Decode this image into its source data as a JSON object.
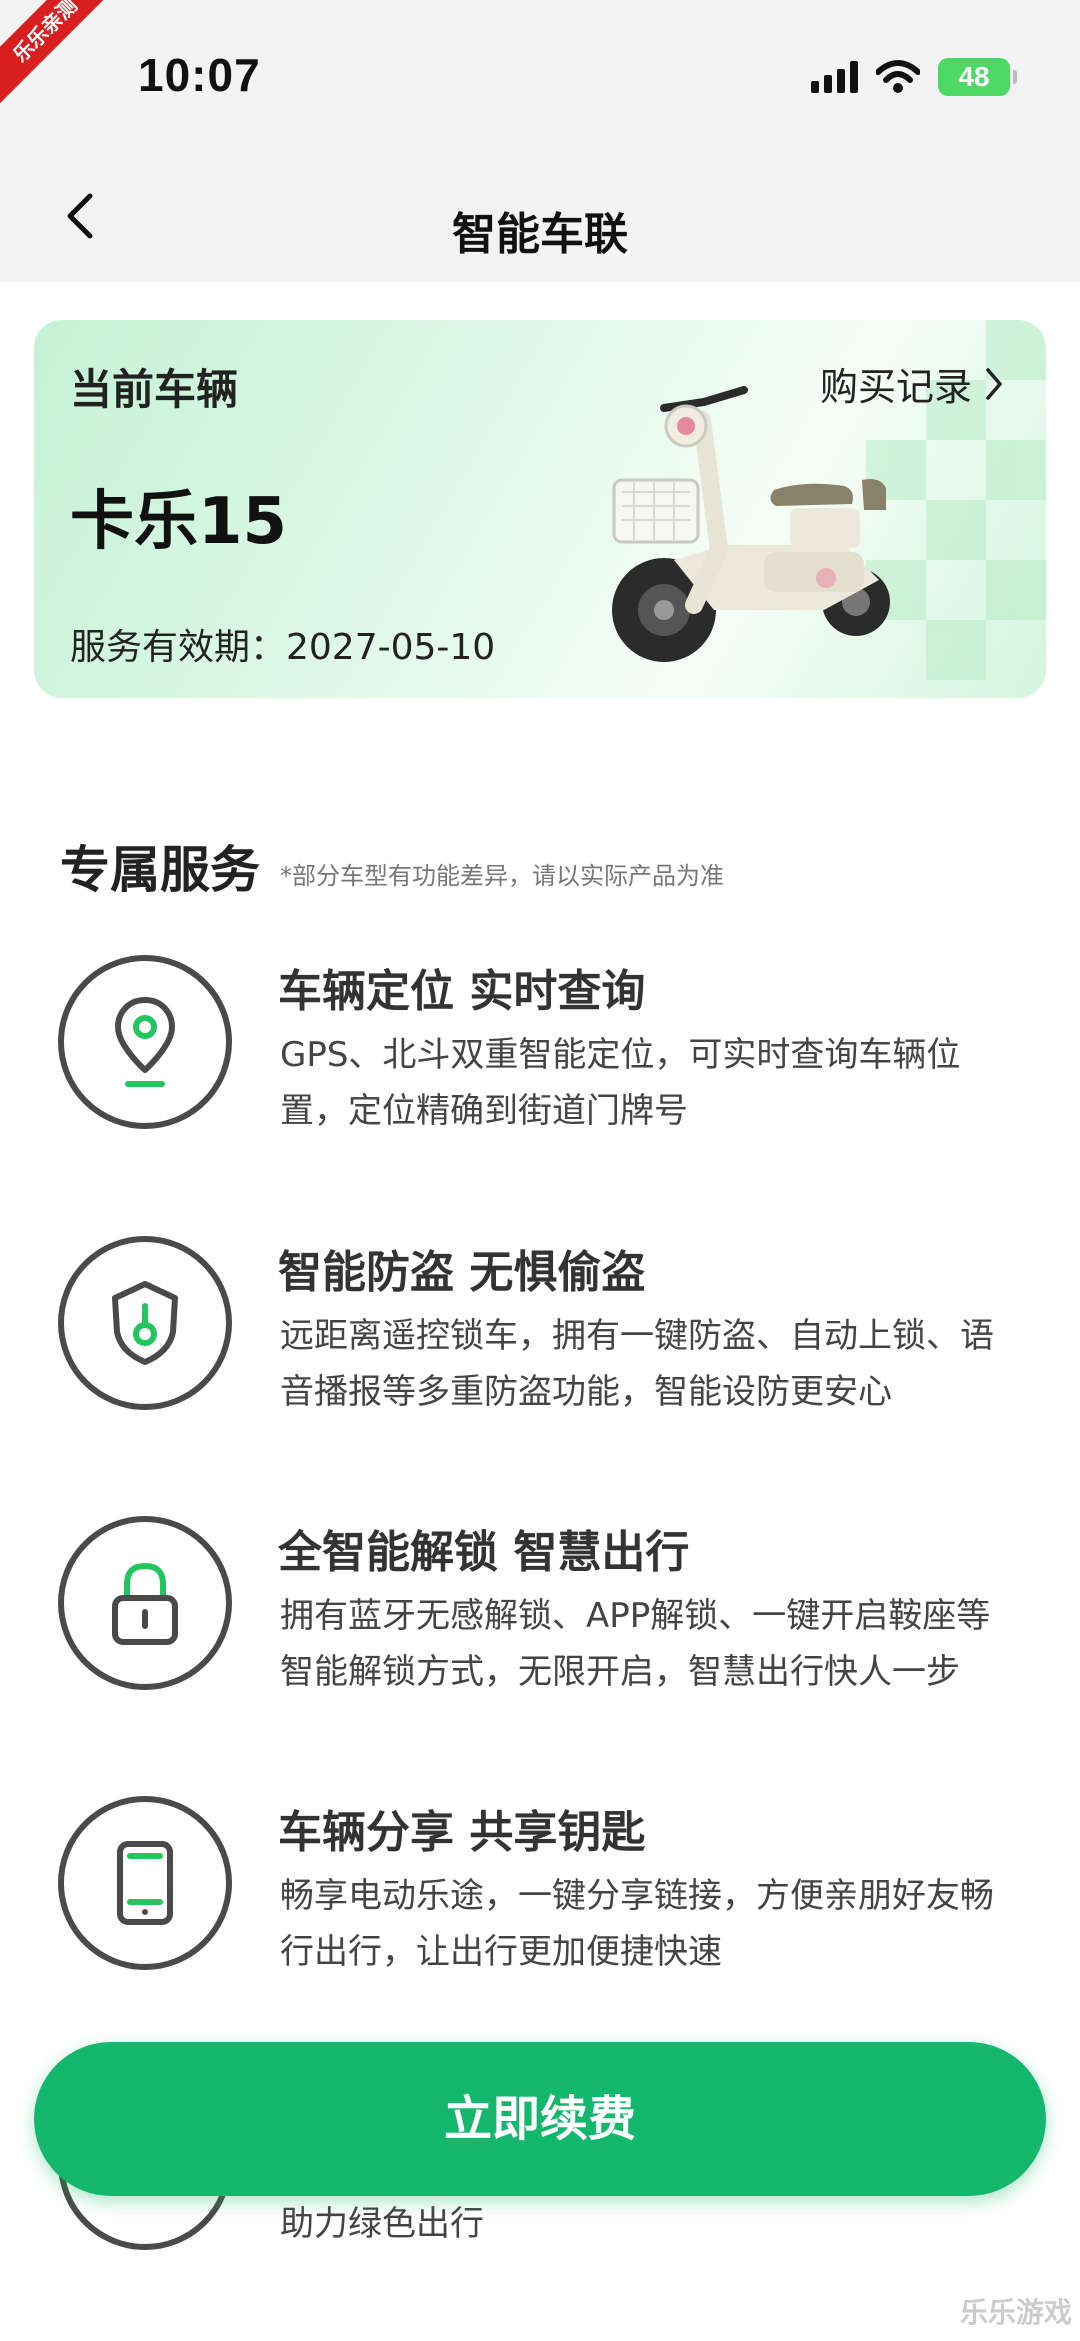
{
  "status_bar": {
    "time": "10:07",
    "battery": "48",
    "ribbon": "乐乐亲测"
  },
  "nav": {
    "title": "智能车联"
  },
  "vehicle": {
    "label": "当前车辆",
    "purchase_link": "购买记录",
    "model": "卡乐15",
    "validity": "服务有效期：2027-05-10"
  },
  "services_section": {
    "title": "专属服务",
    "note": "*部分车型有功能差异，请以实际产品为准",
    "items": [
      {
        "title": "车辆定位 实时查询",
        "desc": "GPS、北斗双重智能定位，可实时查询车辆位置，定位精确到街道门牌号",
        "icon": "location-pin-icon"
      },
      {
        "title": "智能防盗 无惧偷盗",
        "desc": "远距离遥控锁车，拥有一键防盗、自动上锁、语音播报等多重防盗功能，智能设防更安心",
        "icon": "shield-icon"
      },
      {
        "title": "全智能解锁 智慧出行",
        "desc": "拥有蓝牙无感解锁、APP解锁、一键开启鞍座等智能解锁方式，无限开启，智慧出行快人一步",
        "icon": "lock-icon"
      },
      {
        "title": "车辆分享 共享钥匙",
        "desc": "畅享电动乐途，一键分享链接，方便亲朋好友畅行出行，让出行更加便捷快速",
        "icon": "phone-icon"
      },
      {
        "title": "",
        "desc": "助力绿色出行",
        "icon": "scooter-icon"
      }
    ]
  },
  "renew_button": {
    "label": "立即续费"
  },
  "watermark": "乐乐游戏",
  "colors": {
    "accent": "#13b86d",
    "icon_green": "#22c55e",
    "dark": "#4a4a4a"
  }
}
